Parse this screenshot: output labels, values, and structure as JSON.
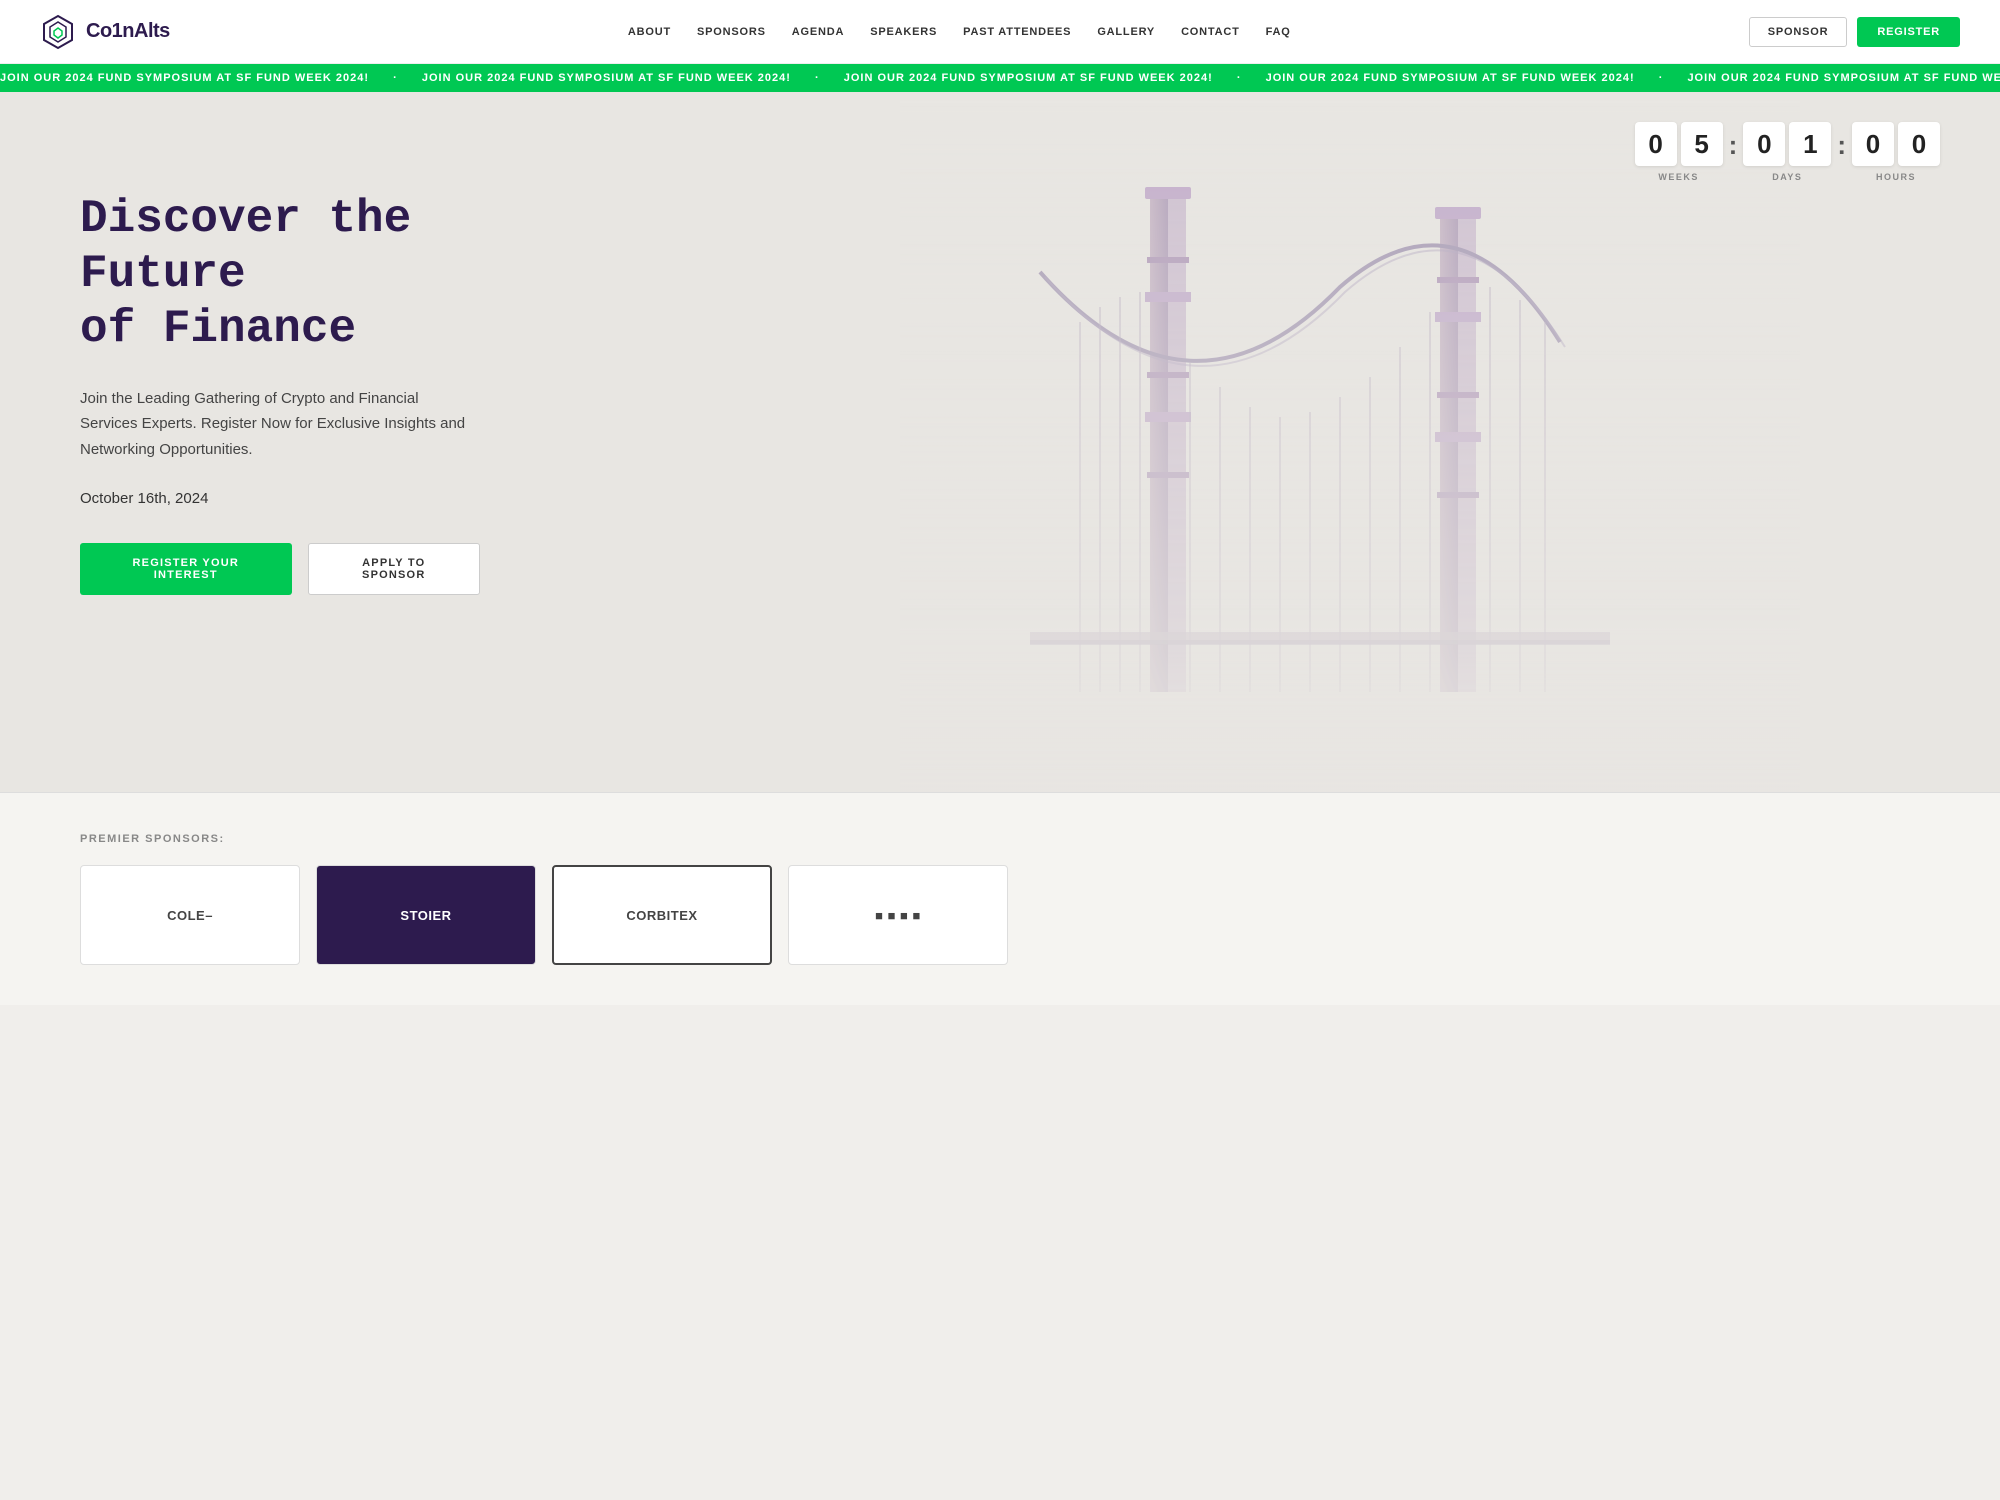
{
  "site": {
    "logo_text": "Co1nAlts",
    "logo_icon": "hexagon-icon"
  },
  "nav": {
    "links": [
      {
        "label": "ABOUT",
        "id": "about"
      },
      {
        "label": "SPONSORS",
        "id": "sponsors"
      },
      {
        "label": "AGENDA",
        "id": "agenda"
      },
      {
        "label": "SPEAKERS",
        "id": "speakers"
      },
      {
        "label": "PAST ATTENDEES",
        "id": "past-attendees"
      },
      {
        "label": "GALLERY",
        "id": "gallery"
      },
      {
        "label": "CONTACT",
        "id": "contact"
      },
      {
        "label": "FAQ",
        "id": "faq"
      }
    ],
    "sponsor_btn": "SPONSOR",
    "register_btn": "REGISTER"
  },
  "ticker": {
    "message": "JOIN OUR 2024 FUND SYMPOSIUM AT SF FUND WEEK 2024!",
    "separator": "·"
  },
  "countdown": {
    "weeks_d1": "0",
    "weeks_d2": "5",
    "days_d1": "0",
    "days_d2": "1",
    "hours_d1": "0",
    "hours_d2": "0",
    "weeks_label": "WEEKS",
    "days_label": "DAYS",
    "hours_label": "HOURS"
  },
  "hero": {
    "title_line1": "Discover the Future",
    "title_line2": "of Finance",
    "subtitle": "Join the Leading Gathering of Crypto and Financial Services Experts. Register Now for Exclusive Insights and Networking Opportunities.",
    "date": "October 16th, 2024",
    "register_btn": "REGISTER YOUR INTEREST",
    "sponsor_btn": "APPLY TO SPONSOR"
  },
  "sponsors": {
    "label": "PREMIER SPONSORS:",
    "items": [
      {
        "name": "COLE–",
        "style": "light"
      },
      {
        "name": "STOIER",
        "style": "dark"
      },
      {
        "name": "CORBITEX",
        "style": "bordered"
      },
      {
        "name": "■ ■ ■ ■",
        "style": "light"
      }
    ]
  }
}
